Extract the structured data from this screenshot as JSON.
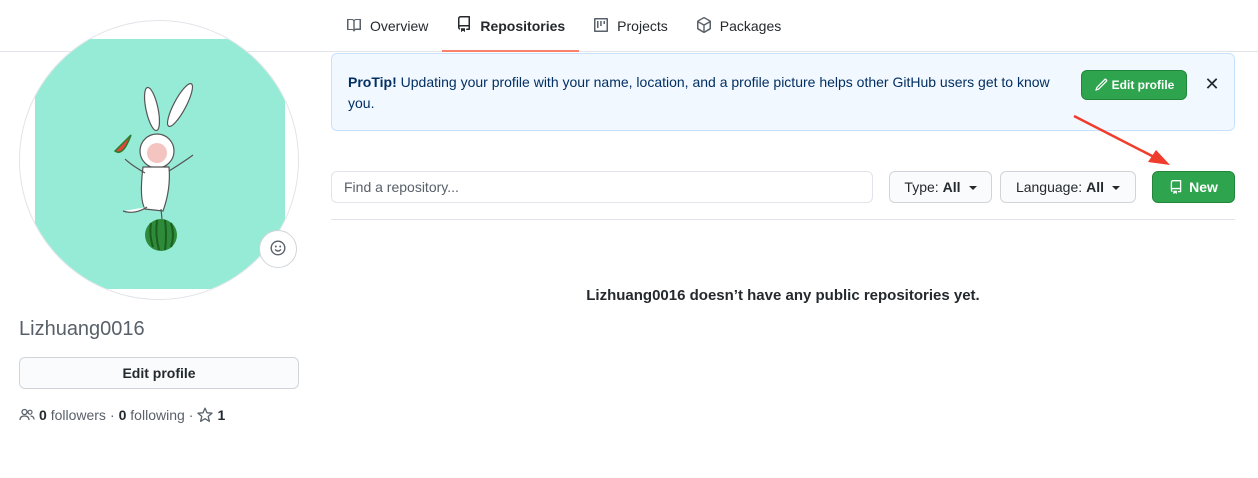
{
  "nav": {
    "tabs": [
      {
        "label": "Overview",
        "icon": "book-icon",
        "selected": false
      },
      {
        "label": "Repositories",
        "icon": "repo-icon",
        "selected": true
      },
      {
        "label": "Projects",
        "icon": "project-icon",
        "selected": false
      },
      {
        "label": "Packages",
        "icon": "package-icon",
        "selected": false
      }
    ]
  },
  "profile": {
    "username": "Lizhuang0016",
    "edit_profile_label": "Edit profile",
    "followers_count": "0",
    "followers_label": "followers",
    "following_count": "0",
    "following_label": "following",
    "stars_count": "1",
    "separator": "·"
  },
  "protip": {
    "title": "ProTip!",
    "text": " Updating your profile with your name, location, and a profile picture helps other GitHub users get to know you.",
    "edit_label": "Edit profile",
    "close_label": "✕"
  },
  "filters": {
    "search_placeholder": "Find a repository...",
    "type_label": "Type:",
    "type_value": "All",
    "language_label": "Language:",
    "language_value": "All",
    "new_label": "New"
  },
  "empty_message": "Lizhuang0016 doesn’t have any public repositories yet.",
  "colors": {
    "accent_green": "#2ea44f",
    "tab_underline": "#f9826c",
    "annotation_arrow": "#f03c2d",
    "avatar_background": "#96ebd6"
  }
}
